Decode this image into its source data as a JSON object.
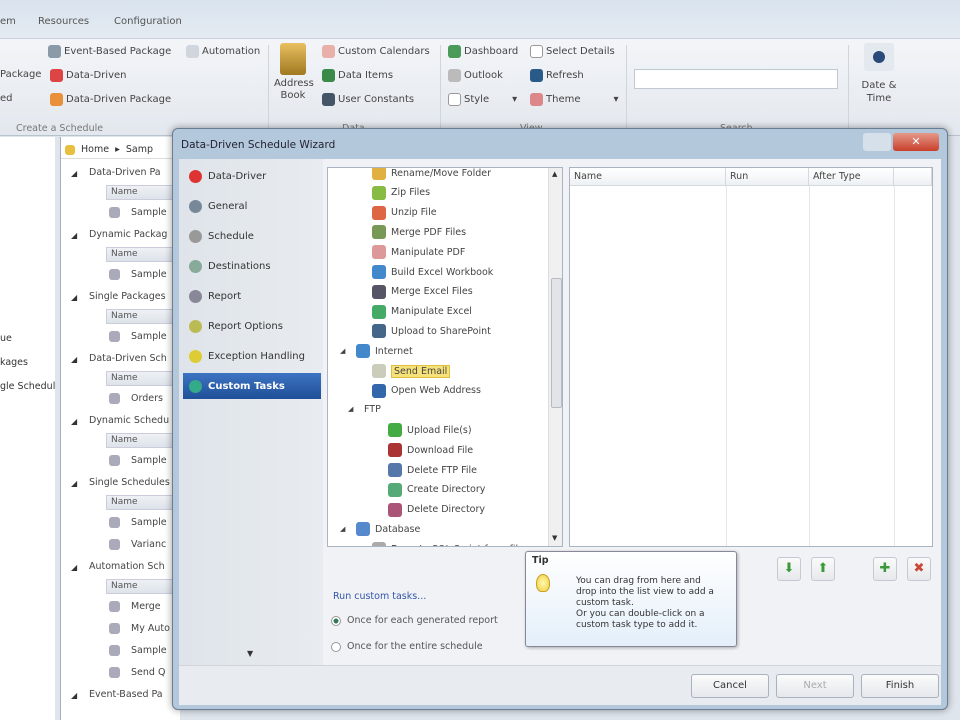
{
  "tabs": [
    "em",
    "Resources",
    "Configuration"
  ],
  "ribbon": {
    "schedule_items": [
      "Event-Based Package",
      "Automation",
      "Package",
      "Data-Driven",
      "ed",
      "Data-Driven Package"
    ],
    "schedule_group": "Create a Schedule",
    "address_book": "Address Book",
    "data_items": [
      "Custom Calendars",
      "Data Items",
      "User Constants"
    ],
    "data_group": "Data",
    "view_items": [
      "Dashboard",
      "Select Details",
      "Outlook",
      "Refresh",
      "Style",
      "Theme"
    ],
    "view_group": "View",
    "search_value": "",
    "search_group": "Search",
    "date_time": "Date & Time"
  },
  "left_pane": [
    "ue",
    "kages",
    "gle Schedul"
  ],
  "explorer": {
    "breadcrumb": [
      "Home",
      "Samp"
    ],
    "sections": [
      {
        "title": "Data-Driven Pa",
        "items": [
          "Sample"
        ]
      },
      {
        "title": "Dynamic Packag",
        "items": [
          "Sample"
        ]
      },
      {
        "title": "Single Packages",
        "items": [
          "Sample"
        ]
      },
      {
        "title": "Data-Driven Sch",
        "items": [
          "Orders"
        ]
      },
      {
        "title": "Dynamic Schedu",
        "items": [
          "Sample"
        ]
      },
      {
        "title": "Single Schedules",
        "items": [
          "Sample",
          "Varianc"
        ]
      },
      {
        "title": "Automation Sch",
        "items": [
          "Merge",
          "My Auto",
          "Sample",
          "Send Q"
        ]
      },
      {
        "title": "Event-Based Pa",
        "items": []
      }
    ],
    "name_header": "Name"
  },
  "dialog": {
    "title": "Data-Driven Schedule Wizard",
    "close": "✕",
    "steps": [
      "Data-Driver",
      "General",
      "Schedule",
      "Destinations",
      "Report",
      "Report Options",
      "Exception Handling",
      "Custom Tasks"
    ],
    "selected_step": "Custom Tasks",
    "tree": [
      {
        "label": "Rename/Move Folder",
        "level": 2
      },
      {
        "label": "Zip Files",
        "level": 2
      },
      {
        "label": "Unzip File",
        "level": 2
      },
      {
        "label": "Merge PDF Files",
        "level": 2
      },
      {
        "label": "Manipulate PDF",
        "level": 2
      },
      {
        "label": "Build Excel Workbook",
        "level": 2
      },
      {
        "label": "Merge Excel Files",
        "level": 2
      },
      {
        "label": "Manipulate Excel",
        "level": 2
      },
      {
        "label": "Upload to SharePoint",
        "level": 2
      },
      {
        "label": "Internet",
        "level": 1
      },
      {
        "label": "Send Email",
        "level": 2
      },
      {
        "label": "Open Web Address",
        "level": 2
      },
      {
        "label": "FTP",
        "level": 2
      },
      {
        "label": "Upload File(s)",
        "level": 3
      },
      {
        "label": "Download File",
        "level": 3
      },
      {
        "label": "Delete FTP File",
        "level": 3
      },
      {
        "label": "Create Directory",
        "level": 3
      },
      {
        "label": "Delete Directory",
        "level": 3
      },
      {
        "label": "Database",
        "level": 1
      },
      {
        "label": "Execute SQL Script from file",
        "level": 2
      }
    ],
    "selected_task": "Send Email",
    "list_columns": [
      "Name",
      "Run",
      "After Type"
    ],
    "run_label": "Run custom tasks...",
    "run_options": [
      "Once for each generated report",
      "Once for the entire schedule"
    ],
    "run_selected": 0,
    "tip_title": "Tip",
    "tip_text": [
      "You can drag from here and",
      "drop into the list view to add a",
      "custom task.",
      "Or you can double-click on a",
      "custom task type to add it."
    ],
    "buttons": {
      "cancel": "Cancel",
      "next": "Next",
      "finish": "Finish"
    }
  }
}
